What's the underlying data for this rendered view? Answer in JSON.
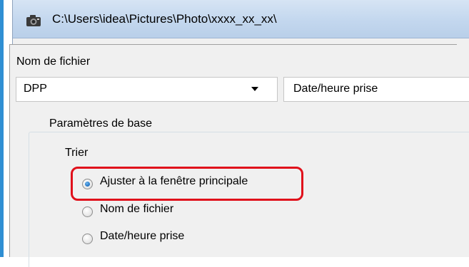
{
  "window": {
    "title": "C:\\Users\\idea\\Pictures\\Photo\\xxxx_xx_xx\\",
    "icon": "camera-icon"
  },
  "filename_section": {
    "label": "Nom de fichier",
    "prefix_value": "DPP",
    "suffix_value": "Date/heure prise"
  },
  "basic_params": {
    "group_title": "Paramètres de base",
    "sort_label": "Trier",
    "options": [
      {
        "label": "Ajuster à la fenêtre principale",
        "checked": true
      },
      {
        "label": "Nom de fichier",
        "checked": false
      },
      {
        "label": "Date/heure prise",
        "checked": false
      }
    ]
  },
  "colors": {
    "highlight": "#e0101b",
    "titlebar": "#c3d7ee",
    "radio_selected": "#1d6fc0"
  }
}
